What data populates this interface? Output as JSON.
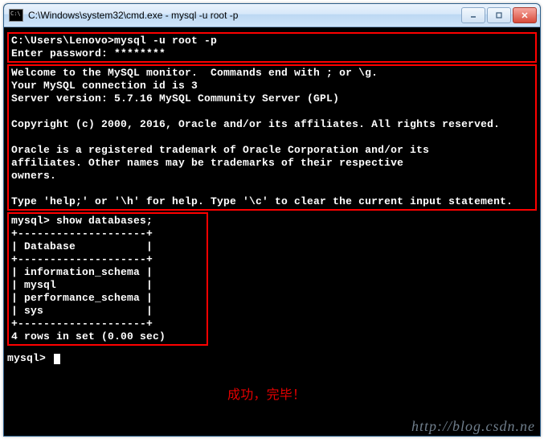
{
  "window": {
    "title": "C:\\Windows\\system32\\cmd.exe - mysql  -u root -p"
  },
  "terminal": {
    "login_cmd": "C:\\Users\\Lenovo>mysql -u root -p",
    "enter_password": "Enter password: ********",
    "welcome_line1": "Welcome to the MySQL monitor.  Commands end with ; or \\g.",
    "welcome_line2": "Your MySQL connection id is 3",
    "welcome_line3": "Server version: 5.7.16 MySQL Community Server (GPL)",
    "copyright": "Copyright (c) 2000, 2016, Oracle and/or its affiliates. All rights reserved.",
    "trademark_line1": "Oracle is a registered trademark of Oracle Corporation and/or its",
    "trademark_line2": "affiliates. Other names may be trademarks of their respective",
    "trademark_line3": "owners.",
    "help_line": "Type 'help;' or '\\h' for help. Type '\\c' to clear the current input statement.",
    "query_cmd": "mysql> show databases;",
    "table_border": "+--------------------+",
    "table_header": "| Database           |",
    "table_row1": "| information_schema |",
    "table_row2": "| mysql              |",
    "table_row3": "| performance_schema |",
    "table_row4": "| sys                |",
    "rows_summary": "4 rows in set (0.00 sec)",
    "prompt": "mysql> "
  },
  "annotation": "成功，完毕！",
  "watermark": "http://blog.csdn.ne"
}
